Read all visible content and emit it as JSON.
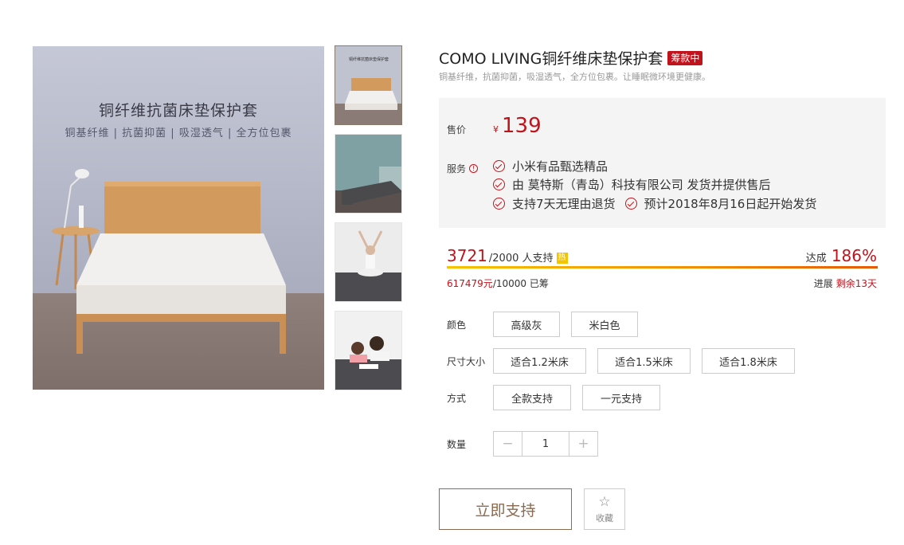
{
  "product": {
    "title": "COMO LIVING铜纤维床垫保护套",
    "status_badge": "筹款中",
    "subtitle": "铜基纤维，抗菌抑菌，吸湿透气，全方位包裹。让睡眠微环境更健康。"
  },
  "gallery": {
    "banner_title": "铜纤维抗菌床垫保护套",
    "banner_subtitle": "铜基纤维 | 抗菌抑菌 | 吸湿透气 | 全方位包裹",
    "thumb_thumbnail_title": "铜纤维抗菌床垫保护套"
  },
  "price": {
    "label": "售价",
    "currency": "¥",
    "value": "139"
  },
  "service": {
    "label": "服务",
    "items": [
      "小米有品甄选精品",
      "由 莫特斯（青岛）科技有限公司 发货并提供售后",
      "支持7天无理由退货",
      "预计2018年8月16日起开始发货"
    ]
  },
  "crowdfunding": {
    "supporters": "3721",
    "supporters_suffix": "/2000 人支持",
    "hot_badge": "热",
    "reach_label": "达成",
    "reach_percent": "186%",
    "progress_fraction": 1.0,
    "raised_amount": "617479元",
    "raised_suffix": "/10000 已筹",
    "remaining_label": "进展",
    "remaining_value": "剩余13天"
  },
  "options": {
    "color_label": "颜色",
    "colors": [
      "高级灰",
      "米白色"
    ],
    "size_label": "尺寸大小",
    "sizes": [
      "适合1.2米床",
      "适合1.5米床",
      "适合1.8米床"
    ],
    "mode_label": "方式",
    "modes": [
      "全款支持",
      "一元支持"
    ],
    "quantity_label": "数量",
    "quantity_value": "1",
    "minus": "−",
    "plus": "+"
  },
  "actions": {
    "support_button": "立即支持",
    "favorite_label": "收藏",
    "favorite_icon": "☆"
  },
  "colors": {
    "accent_red": "#c0131c",
    "button_brown": "#8a6a50"
  }
}
